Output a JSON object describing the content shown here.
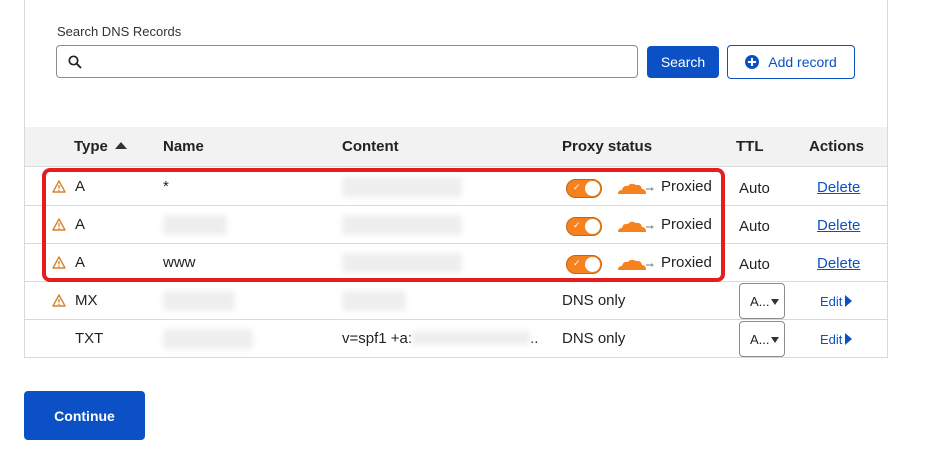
{
  "search": {
    "label": "Search DNS Records",
    "placeholder": "",
    "value": "",
    "button_label": "Search"
  },
  "add_record": {
    "label": "Add record"
  },
  "table": {
    "columns": {
      "type": "Type",
      "name": "Name",
      "content": "Content",
      "proxy_status": "Proxy status",
      "ttl": "TTL",
      "actions": "Actions"
    },
    "rows": [
      {
        "type": "A",
        "name": "*",
        "content": "",
        "proxy": "Proxied",
        "ttl": "Auto",
        "action": "Delete"
      },
      {
        "type": "A",
        "name": "",
        "content": "",
        "proxy": "Proxied",
        "ttl": "Auto",
        "action": "Delete"
      },
      {
        "type": "A",
        "name": "www",
        "content": "",
        "proxy": "Proxied",
        "ttl": "Auto",
        "action": "Delete"
      },
      {
        "type": "MX",
        "name": "",
        "content": "",
        "proxy": "DNS only",
        "ttl": "A...",
        "action": "Edit"
      },
      {
        "type": "TXT",
        "name": "",
        "content": "v=spf1 +a:",
        "content_ellipsis": "..",
        "proxy": "DNS only",
        "ttl": "A...",
        "action": "Edit"
      }
    ]
  },
  "continue": {
    "label": "Continue"
  },
  "colors": {
    "primary": "#0b51c5",
    "proxied_orange": "#f6821f",
    "highlight_red": "#e51d1d",
    "warning": "#d9822b"
  },
  "icons": {
    "search": "search-icon",
    "add": "plus-circle-icon",
    "warning": "warning-triangle-icon",
    "cloud": "orange-cloud-icon",
    "sort": "sort-ascending-icon"
  }
}
